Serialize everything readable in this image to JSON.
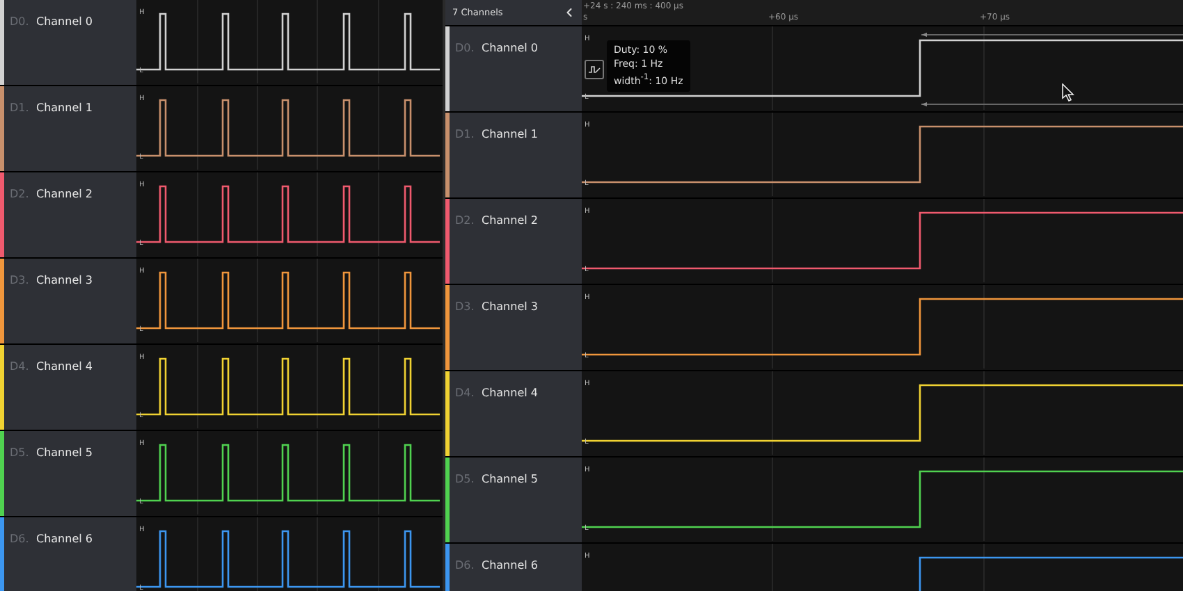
{
  "left_panel": {
    "channels": [
      {
        "index": "D0.",
        "name": "Channel 0",
        "color": "#d2d2d2",
        "high": "H",
        "low": "L"
      },
      {
        "index": "D1.",
        "name": "Channel 1",
        "color": "#c8906c",
        "high": "H",
        "low": "L"
      },
      {
        "index": "D2.",
        "name": "Channel 2",
        "color": "#f05a6e",
        "high": "H",
        "low": "L"
      },
      {
        "index": "D3.",
        "name": "Channel 3",
        "color": "#f0963c",
        "high": "H",
        "low": "L"
      },
      {
        "index": "D4.",
        "name": "Channel 4",
        "color": "#f0d232",
        "high": "H",
        "low": "L"
      },
      {
        "index": "D5.",
        "name": "Channel 5",
        "color": "#50d250",
        "high": "H",
        "low": "L"
      },
      {
        "index": "D6.",
        "name": "Channel 6",
        "color": "#3c96f0",
        "high": "H",
        "low": "L"
      }
    ]
  },
  "right_panel": {
    "header": {
      "title": "7 Channels"
    },
    "ruler": {
      "origin": "+24 s : 240 ms : 400 µs",
      "origin_wrap": "s",
      "ticks": [
        "+60 µs",
        "+70 µs"
      ]
    },
    "measurement": {
      "lines": [
        "Duty: 10 %",
        "Freq: 1 Hz",
        "width$^{-1}$: 10 Hz"
      ]
    },
    "channels": [
      {
        "index": "D0.",
        "name": "Channel 0",
        "color": "#d2d2d2",
        "high": "H",
        "low": "L"
      },
      {
        "index": "D1.",
        "name": "Channel 1",
        "color": "#c8906c",
        "high": "H",
        "low": "L"
      },
      {
        "index": "D2.",
        "name": "Channel 2",
        "color": "#f05a6e",
        "high": "H",
        "low": "L"
      },
      {
        "index": "D3.",
        "name": "Channel 3",
        "color": "#f0963c",
        "high": "H",
        "low": "L"
      },
      {
        "index": "D4.",
        "name": "Channel 4",
        "color": "#f0d232",
        "high": "H",
        "low": "L"
      },
      {
        "index": "D5.",
        "name": "Channel 5",
        "color": "#50d250",
        "high": "H",
        "low": "L"
      },
      {
        "index": "D6.",
        "name": "Channel 6",
        "color": "#3c96f0",
        "high": "H"
      }
    ]
  }
}
